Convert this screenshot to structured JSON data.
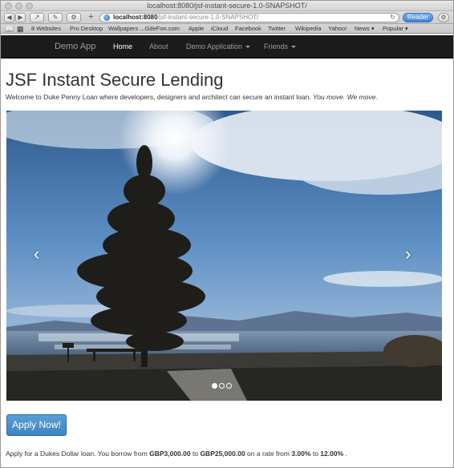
{
  "window": {
    "title": "localhost:8080/jsf-instant-secure-1.0-SNAPSHOT/"
  },
  "toolbar": {
    "url_host": "localhost:8080",
    "url_path": "/jsf-instant-secure-1.0-SNAPSHOT/",
    "reader_label": "Reader"
  },
  "bookmarks": [
    "8 Websites",
    "Pro Desktop",
    "Wallpapers ...GdeFon.com",
    "Apple",
    "iCloud",
    "Facebook",
    "Twitter",
    "Wikipedia",
    "Yahoo!",
    "News ▾",
    "Popular ▾"
  ],
  "navbar": {
    "brand": "Demo App",
    "links": [
      "Home",
      "About",
      "Demo Application",
      "Friends"
    ]
  },
  "page": {
    "title": "JSF Instant Secure Lending",
    "lead_main": "Welcome to Duke Penny Loan where developers, designers and architect can secure an instant loan.",
    "lead_emphasis": "You move. We move.",
    "apply_button": "Apply Now!",
    "footer": {
      "p1": "Apply for a Dukes Dollar loan. You borrow from",
      "min_amount": "GBP3,000.00",
      "p2": "to",
      "max_amount": "GBP25,000.00",
      "p3": "on a rate from",
      "min_rate": "3.00%",
      "p4": "to",
      "max_rate": "12.00%",
      "p5": "."
    }
  },
  "carousel": {
    "prev_icon": "chevron-left-icon",
    "next_icon": "chevron-right-icon",
    "prev_glyph": "‹",
    "next_glyph": "›",
    "slide_count": 3,
    "active_slide": 1
  },
  "colors": {
    "navbar_bg": "#1b1b1b",
    "button_primary": "#428bca",
    "reader_blue": "#3d83d6"
  }
}
